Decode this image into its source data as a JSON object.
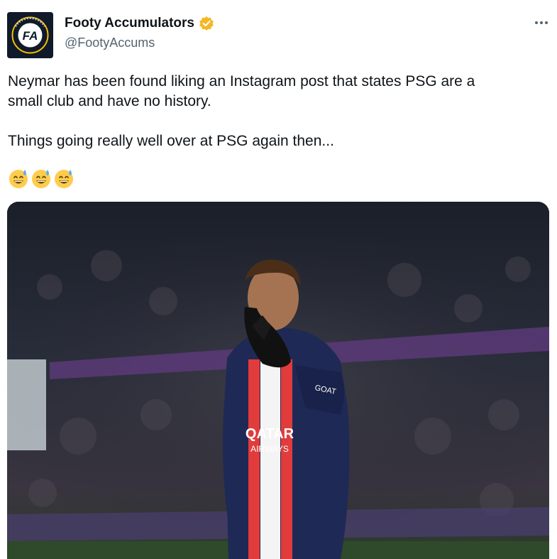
{
  "account": {
    "display_name": "Footy Accumulators",
    "handle": "@FootyAccums",
    "verified_badge_color": "#f4b824",
    "avatar_label": "FOOTY ACCUMULATORS"
  },
  "tweet": {
    "line1": "Neymar has been found liking an Instagram post that states PSG are a",
    "line2": "small club and have no history.",
    "line3": "Things going really well over at PSG again then...",
    "emojis": [
      "grinning-sweat-emoji",
      "grinning-sweat-emoji",
      "grinning-sweat-emoji"
    ]
  },
  "media": {
    "shirt_sponsor_line1": "QATAR",
    "shirt_sponsor_line2": "AIRWAYS",
    "sleeve_text": "GOAT",
    "colors": {
      "shirt": "#1e2a55",
      "stripe": "#e23b3b",
      "banner": "#5b3a78"
    }
  }
}
